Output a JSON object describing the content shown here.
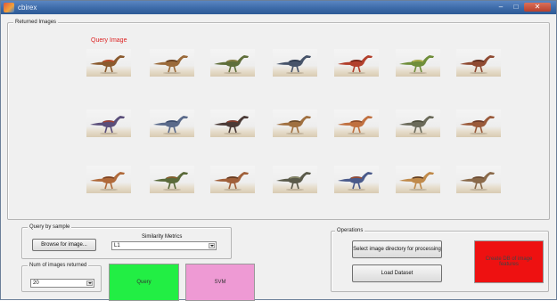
{
  "window": {
    "title": "cbirex",
    "controls": {
      "minimize": "–",
      "maximize": "□",
      "close": "✕"
    }
  },
  "returned_images": {
    "legend": "Returned Images",
    "query_label": "Query Image",
    "rows": [
      [
        {
          "body": "#8a5a2e",
          "stripe": "#c44a2a"
        },
        {
          "body": "#9a6a3a",
          "stripe": "#5e3a1e"
        },
        {
          "body": "#5f6e3a",
          "stripe": "#8c7f42"
        },
        {
          "body": "#47546a",
          "stripe": "#2e3a4e"
        },
        {
          "body": "#b2402c",
          "stripe": "#6e2418"
        },
        {
          "body": "#6f8e3a",
          "stripe": "#b7b24e"
        },
        {
          "body": "#8f4a32",
          "stripe": "#5a2c1e"
        }
      ],
      [
        {
          "body": "#5a4e7a",
          "stripe": "#a04030"
        },
        {
          "body": "#5a6a8a",
          "stripe": "#3a4a6a"
        },
        {
          "body": "#4a3a36",
          "stripe": "#8a3a2a"
        },
        {
          "body": "#a07040",
          "stripe": "#6a4a2a"
        },
        {
          "body": "#c07040",
          "stripe": "#8a4a2a"
        },
        {
          "body": "#6a6a5a",
          "stripe": "#4a4a3a"
        },
        {
          "body": "#9a5a3a",
          "stripe": "#6a3a2a"
        }
      ],
      [
        {
          "body": "#b06a3a",
          "stripe": "#7a4020"
        },
        {
          "body": "#5a6a3a",
          "stripe": "#8a5a2a"
        },
        {
          "body": "#a0603a",
          "stripe": "#603820"
        },
        {
          "body": "#5a5a4a",
          "stripe": "#8a8a6a"
        },
        {
          "body": "#4a5a8a",
          "stripe": "#a04a2a"
        },
        {
          "body": "#c08a4a",
          "stripe": "#5a3a22"
        },
        {
          "body": "#8a6a4a",
          "stripe": "#6a4a32"
        }
      ]
    ]
  },
  "query_by_sample": {
    "legend": "Query by sample",
    "browse_label": "Browse for image...",
    "similarity_label": "Similarity Metrics",
    "similarity_value": "L1"
  },
  "num_images": {
    "legend": "Num of images returned",
    "value": "20"
  },
  "actions": {
    "query_label": "Query",
    "query_color": "#22ee44",
    "svm_label": "SVM",
    "svm_color": "#ee9ad4"
  },
  "operations": {
    "legend": "Operations",
    "select_dir_label": "Select image directory for processing",
    "load_dataset_label": "Load Dataset",
    "create_db_label": "Create DB of image features",
    "create_db_color": "#ee1111"
  }
}
